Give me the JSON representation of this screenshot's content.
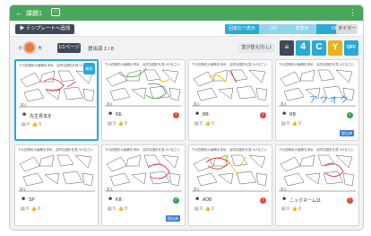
{
  "topbar": {
    "back_icon": "←",
    "title": "課題1",
    "edit_icon": "□",
    "menu_icon": "⋮",
    "color": "#4aa65c"
  },
  "toolbar1": {
    "template_button": "▶ テンプレートへ追加",
    "mode_label": "回答比べ表示",
    "mode_a": "ON",
    "mode_b": "非表示",
    "mode_off": "OFF",
    "timer": "タイマー"
  },
  "toolbar2": {
    "zoom_small": "小",
    "zoom_large": "大",
    "pager": "1/1ページ",
    "submitted": "提出済 2 / 8",
    "sort": "並び替え(なし)",
    "tools": {
      "list": "≡",
      "four": "4",
      "c": "C",
      "y": "Y",
      "off": "OFF"
    }
  },
  "question_text": "下の四角形の面積を求め、合同な図形を見つけなさい",
  "cards": [
    {
      "name": "先生見本を",
      "status": "",
      "likes": "0",
      "comments": "0",
      "selected": true,
      "bookmark": "解答",
      "send": ""
    },
    {
      "name": "RE",
      "status": "ng",
      "likes": "0",
      "comments": "0",
      "selected": false,
      "bookmark": "",
      "send": ""
    },
    {
      "name": "BB",
      "status": "ng",
      "likes": "0",
      "comments": "0",
      "selected": false,
      "bookmark": "",
      "send": ""
    },
    {
      "name": "RB",
      "status": "ok",
      "likes": "0",
      "comments": "0",
      "selected": false,
      "bookmark": "",
      "send": "提出済",
      "overlay": "ア ウ オ ク"
    },
    {
      "name": "SP",
      "status": "",
      "likes": "0",
      "comments": "0",
      "selected": false,
      "bookmark": "",
      "send": ""
    },
    {
      "name": "KB",
      "status": "ok",
      "likes": "0",
      "comments": "0",
      "selected": false,
      "bookmark": "",
      "send": "提出済"
    },
    {
      "name": "ADB",
      "status": "ng",
      "likes": "0",
      "comments": "0",
      "selected": false,
      "bookmark": "",
      "send": ""
    },
    {
      "name": "ニックネーム11",
      "status": "ng",
      "likes": "0",
      "comments": "0",
      "selected": false,
      "bookmark": "",
      "send": ""
    }
  ],
  "answer_label": "答え",
  "colors": {
    "accent": "#29a9d5",
    "ok": "#2fa350",
    "ng": "#e4493b",
    "ink_red": "#e53935",
    "ink_green": "#4caf50",
    "ink_blue": "#1e88e5",
    "ink_yellow": "#f2c200"
  }
}
